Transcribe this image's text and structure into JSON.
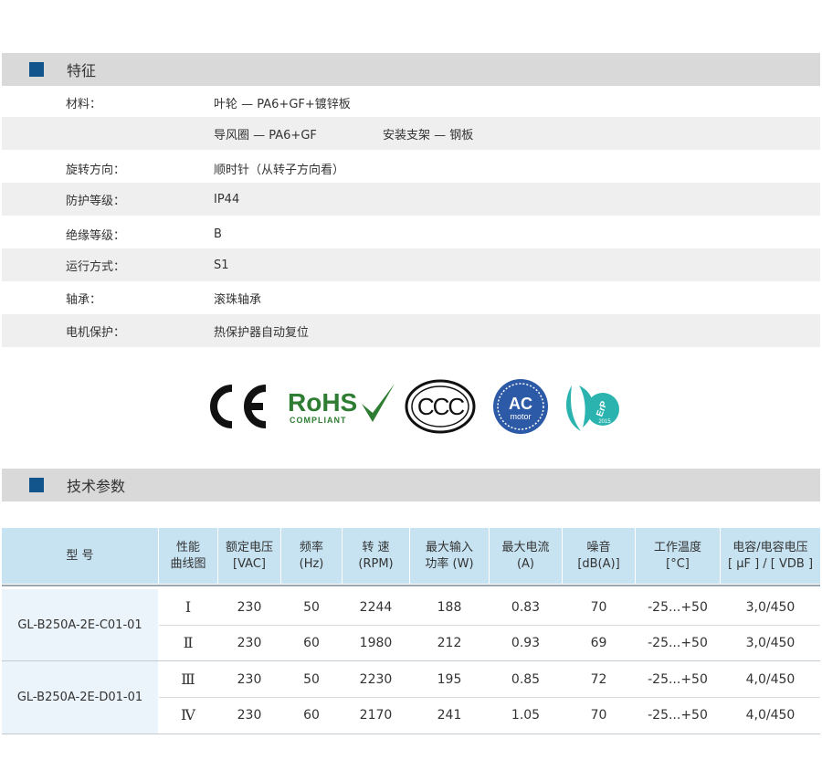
{
  "features": {
    "title": "特征",
    "rows": [
      {
        "label": "材料：",
        "value": "叶轮 — PA6+GF+镀锌板",
        "value2": ""
      },
      {
        "label": "",
        "value": "导风圈 — PA6+GF",
        "value2": "安装支架 — 钢板"
      },
      {
        "label": "旋转方向：",
        "value": "顺时针（从转子方向看）",
        "value2": ""
      },
      {
        "label": "防护等级：",
        "value": "IP44",
        "value2": ""
      },
      {
        "label": "绝缘等级：",
        "value": "B",
        "value2": ""
      },
      {
        "label": "运行方式：",
        "value": "S1",
        "value2": ""
      },
      {
        "label": "轴承：",
        "value": "滚珠轴承",
        "value2": ""
      },
      {
        "label": "电机保护：",
        "value": "热保护器自动复位",
        "value2": ""
      }
    ]
  },
  "certifications": {
    "ce": "CE",
    "rohs": "RoHS",
    "rohs_sub": "COMPLIANT",
    "ccc": "CCC",
    "ac_motor_top": "AC",
    "ac_motor_bottom": "motor",
    "erp": "ErP",
    "erp_year": "2015"
  },
  "specs": {
    "title": "技术参数",
    "headers": [
      [
        "型 号"
      ],
      [
        "性能",
        "曲线图"
      ],
      [
        "额定电压",
        "[VAC]"
      ],
      [
        "频率",
        "(Hz)"
      ],
      [
        "转 速",
        "(RPM)"
      ],
      [
        "最大输入",
        "功率 (W)"
      ],
      [
        "最大电流",
        "(A)"
      ],
      [
        "噪音",
        "[dB(A)]"
      ],
      [
        "工作温度",
        "[°C]"
      ],
      [
        "电容/电容电压",
        "[ μF ] / [ VDB ]"
      ]
    ],
    "models": [
      {
        "name": "GL-B250A-2E-C01-01",
        "rows": [
          {
            "curve": "Ⅰ",
            "voltage": "230",
            "freq": "50",
            "rpm": "2244",
            "power": "188",
            "current": "0.83",
            "noise": "70",
            "temp": "-25...+50",
            "cap": "3,0/450"
          },
          {
            "curve": "Ⅱ",
            "voltage": "230",
            "freq": "60",
            "rpm": "1980",
            "power": "212",
            "current": "0.93",
            "noise": "69",
            "temp": "-25...+50",
            "cap": "3,0/450"
          }
        ]
      },
      {
        "name": "GL-B250A-2E-D01-01",
        "rows": [
          {
            "curve": "Ⅲ",
            "voltage": "230",
            "freq": "50",
            "rpm": "2230",
            "power": "195",
            "current": "0.85",
            "noise": "72",
            "temp": "-25...+50",
            "cap": "4,0/450"
          },
          {
            "curve": "Ⅳ",
            "voltage": "230",
            "freq": "60",
            "rpm": "2170",
            "power": "241",
            "current": "1.05",
            "noise": "70",
            "temp": "-25...+50",
            "cap": "4,0/450"
          }
        ]
      }
    ]
  },
  "colors": {
    "section_bar": "#d9d9d9",
    "section_square": "#12548c",
    "table_header": "#c7e3f2",
    "model_cell": "#eaf4fa",
    "rohs_green": "#2e7d32",
    "ac_blue": "#2d5aa6",
    "erp_teal": "#2bb3b0"
  }
}
